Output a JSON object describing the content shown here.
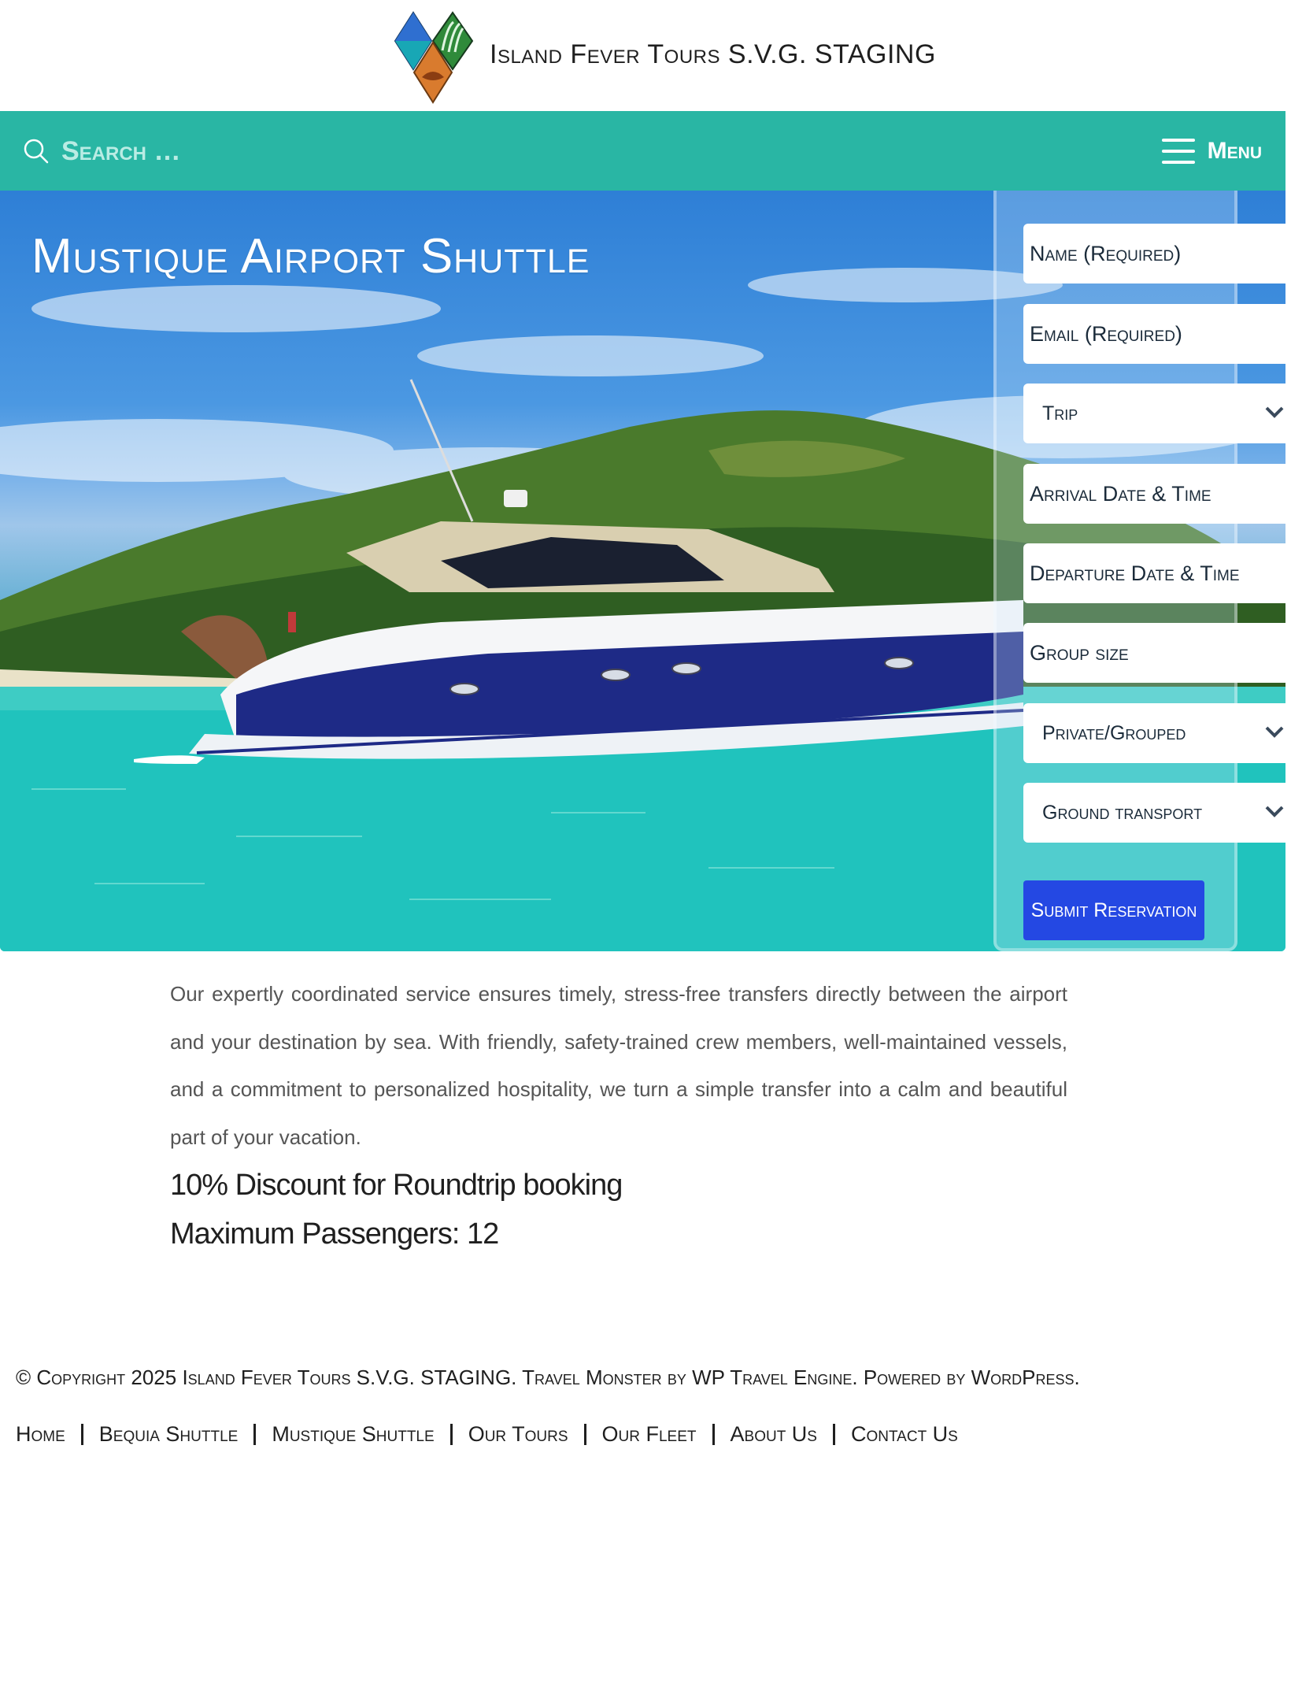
{
  "header": {
    "site_title": "Island Fever Tours S.V.G. STAGING"
  },
  "navbar": {
    "search_placeholder": "Search …",
    "menu_label": "Menu"
  },
  "hero": {
    "title": "Mustique Airport Shuttle"
  },
  "booking_form": {
    "name_placeholder": "Name (Required)",
    "email_placeholder": "Email (Required)",
    "trip_select": "Trip",
    "arrival_placeholder": "Arrival Date & Time",
    "departure_placeholder": "Departure Date & Time",
    "group_size_placeholder": "Group size",
    "private_grouped_select": "Private/Grouped",
    "ground_transport_select": "Ground transport",
    "submit_label": "Submit Reservation"
  },
  "content": {
    "intro": "Our expertly coordinated service ensures timely, stress-free transfers directly between the airport and your destination by sea. With friendly, safety-trained crew members, well-maintained vessels, and a commitment to personalized hospitality, we turn a simple transfer into a calm and beautiful part of your vacation.",
    "discount": "10% Discount for Roundtrip booking",
    "max_passengers": "Maximum Passengers: 12"
  },
  "footer": {
    "copyright": "© Copyright 2025 Island Fever Tours S.V.G. STAGING. Travel Monster by WP Travel Engine. Powered by WordPress.",
    "nav": [
      "Home",
      "Bequia Shuttle",
      "Mustique Shuttle",
      "Our Tours",
      "Our Fleet",
      "About Us",
      "Contact Us"
    ]
  },
  "colors": {
    "nav_bg": "#29b6a4",
    "submit_bg": "#2448e3",
    "hull_navy": "#1e2a86"
  }
}
